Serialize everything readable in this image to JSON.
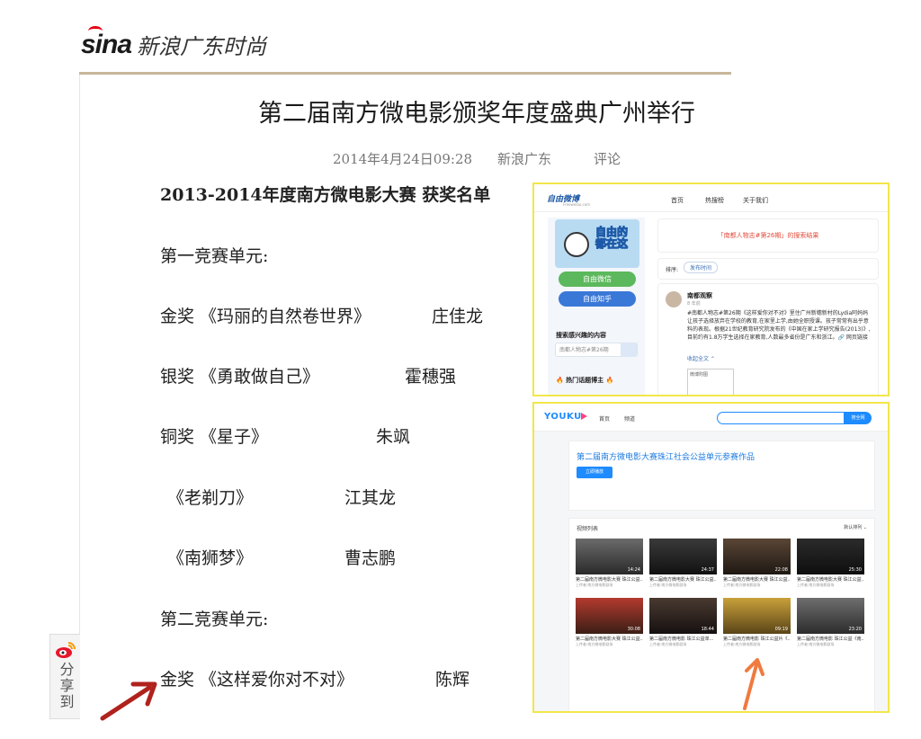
{
  "site": {
    "logo_mark": "sina",
    "logo_text": "新浪广东时尚"
  },
  "article": {
    "title": "第二届南方微电影颁奖年度盛典广州举行",
    "date": "2014年4月24日09:28",
    "source": "新浪广东",
    "comment": "评论",
    "lines": [
      "2013-2014年度南方微电影大赛 获奖名单",
      "第一竞赛单元:",
      "金奖 《玛丽的自然卷世界》",
      "庄佳龙",
      "银奖 《勇敢做自己》",
      "霍穗强",
      "铜奖 《星子》",
      "朱飒",
      "《老剃刀》",
      "江其龙",
      "《南狮梦》",
      "曹志鹏",
      "第二竞赛单元:",
      "金奖 《这样爱你对不对》",
      "陈辉"
    ]
  },
  "share": {
    "label": "分享到"
  },
  "panel1": {
    "logo": "自由微博",
    "logo_sub": "Freeweibo.com",
    "nav": [
      "首页",
      "热搜榜",
      "关于我们"
    ],
    "hero_text": "自由的 都在这",
    "btn_weixin": "自由微信",
    "btn_zhihu": "自由知乎",
    "search_title": "搜索感兴趣的内容",
    "search_placeholder": "南都人物志#第26期",
    "hot_title": "🔥 热门话题博主 🔥",
    "result_text": "「南都人物志#第26期」的搜索结果",
    "sort_label": "排序:",
    "sort_value": "发布时间",
    "post_name": "南都观察",
    "post_time": "8 年前",
    "post_body": "#南都人物志#第26期《这样爱你对不对》里住广州新穗新村的Lydia阿妈妈让孩子选择放弃在学校的教育,在家里上学,由她全职授课。孩子常常有出乎意料的表现。根据21世纪教育研究院发布的《中国在家上学研究报告(2013)》,目前约有1.8万学生选择在家教育,人数最多省份是广东和浙江。🔗 网页链接",
    "more": "收起全文 ⌃",
    "img_label": "微博附图"
  },
  "panel2": {
    "logo": "YOUKU",
    "nav": [
      "首页",
      "频道"
    ],
    "search_btn": "搜全网",
    "hero_title": "第二届南方微电影大赛珠江社会公益单元参赛作品",
    "hero_btn": "立即播放",
    "list_title": "视频列表",
    "list_sort": "默认排列 ⌄",
    "videos": [
      {
        "dur": "14:24",
        "title": "第二届南方微电影大赛 珠江公益...",
        "sub": "上传者:南方微电影剧场"
      },
      {
        "dur": "24:37",
        "title": "第二届南方微电影大赛 珠江公益...",
        "sub": "上传者:南方微电影剧场"
      },
      {
        "dur": "22:08",
        "title": "第二届南方微电影大赛 珠江公益...",
        "sub": "上传者:南方微电影剧场"
      },
      {
        "dur": "25:30",
        "title": "第二届南方微电影大赛 珠江公益...",
        "sub": "上传者:南方微电影剧场"
      },
      {
        "dur": "30:08",
        "title": "第二届南方微电影大赛 珠江公益...",
        "sub": "上传者:南方微电影剧场"
      },
      {
        "dur": "18:44",
        "title": "第二届南方微电影 珠江公益单...",
        "sub": "上传者:南方微电影剧场"
      },
      {
        "dur": "09:19",
        "title": "第二届南方微电影 珠江公益片《...",
        "sub": "上传者:南方微电影剧场"
      },
      {
        "dur": "23:20",
        "title": "第二届南方微电影 珠江公益《南...",
        "sub": "上传者:南方微电影剧场"
      }
    ]
  },
  "colors": {
    "panel_border": "#f2e64a",
    "arrow_red": "#b0221c",
    "arrow_orange": "#f07a3f",
    "rule": "#c7b69a"
  }
}
